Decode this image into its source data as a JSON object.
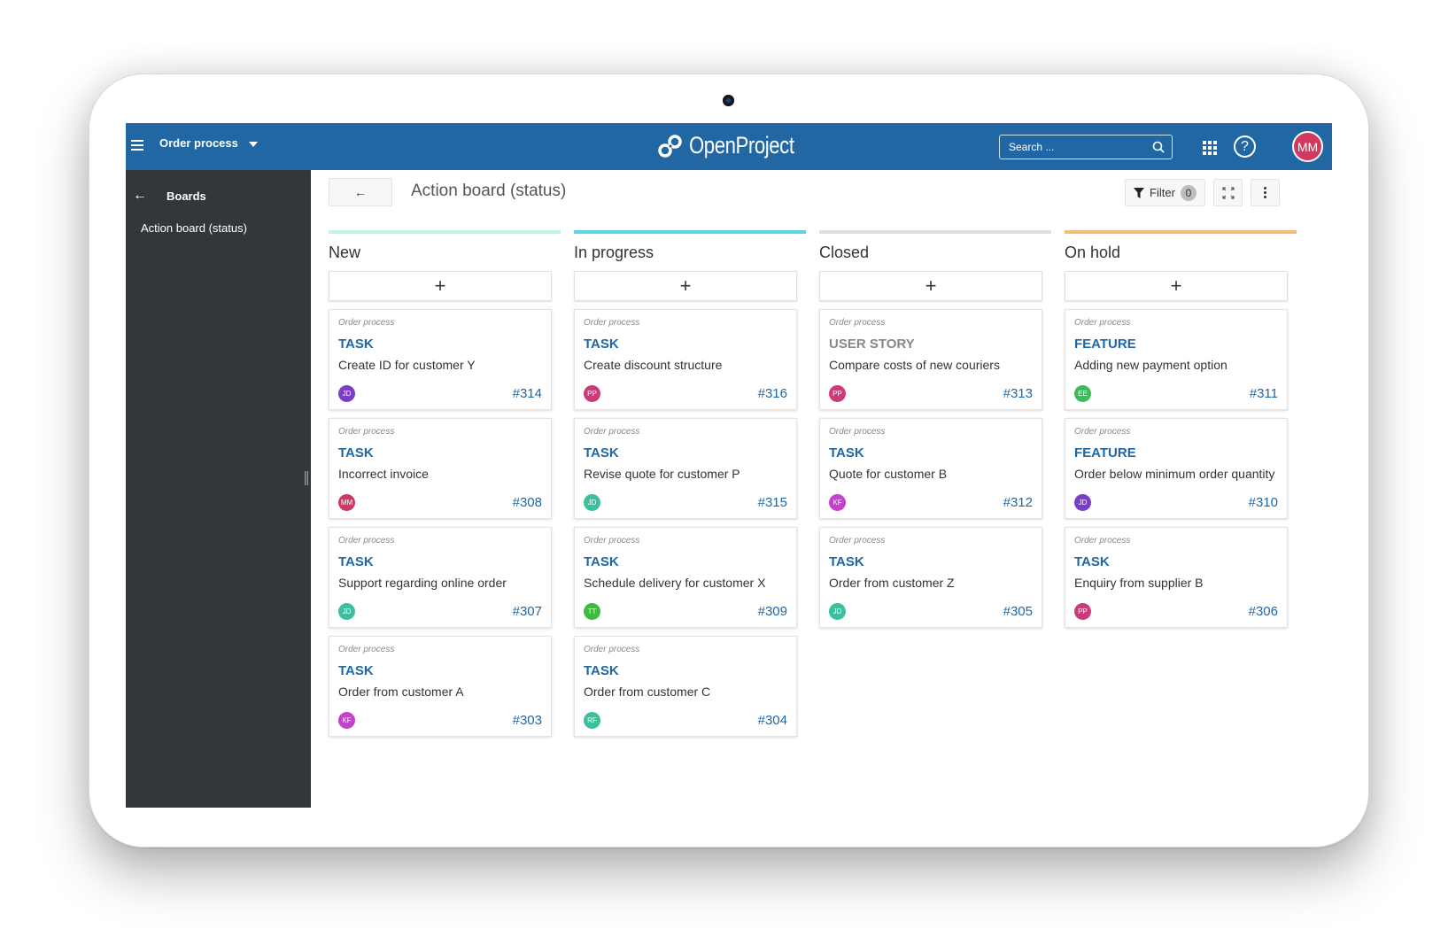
{
  "header": {
    "project_name": "Order process",
    "logo_text": "OpenProject",
    "search_placeholder": "Search ...",
    "user_initials": "MM",
    "brand_color": "#2067a3"
  },
  "sidebar": {
    "back_label": "Boards",
    "items": [
      {
        "label": "Action board (status)"
      }
    ]
  },
  "toolbar": {
    "back_icon": "←",
    "title": "Action board (status)",
    "filter_label": "Filter",
    "filter_count": "0"
  },
  "columns": [
    {
      "title": "New",
      "color": "#c3f5e3",
      "add_label": "+",
      "cards": [
        {
          "project": "Order process",
          "type": "TASK",
          "type_color": "#2067a3",
          "subject": "Create ID for customer Y",
          "initials": "JD",
          "avatar_color": "#7b3cc8",
          "id": "#314"
        },
        {
          "project": "Order process",
          "type": "TASK",
          "type_color": "#2067a3",
          "subject": "Incorrect invoice",
          "initials": "MM",
          "avatar_color": "#c73b66",
          "id": "#308"
        },
        {
          "project": "Order process",
          "type": "TASK",
          "type_color": "#2067a3",
          "subject": "Support regarding online order",
          "initials": "JD",
          "avatar_color": "#3dbf9e",
          "id": "#307"
        },
        {
          "project": "Order process",
          "type": "TASK",
          "type_color": "#2067a3",
          "subject": "Order from customer A",
          "initials": "KF",
          "avatar_color": "#c441c9",
          "id": "#303"
        }
      ]
    },
    {
      "title": "In progress",
      "color": "#5bd5e5",
      "add_label": "+",
      "cards": [
        {
          "project": "Order process",
          "type": "TASK",
          "type_color": "#2067a3",
          "subject": "Create discount structure",
          "initials": "PP",
          "avatar_color": "#cc3a7a",
          "id": "#316"
        },
        {
          "project": "Order process",
          "type": "TASK",
          "type_color": "#2067a3",
          "subject": "Revise quote for customer P",
          "initials": "JD",
          "avatar_color": "#3dbf9e",
          "id": "#315"
        },
        {
          "project": "Order process",
          "type": "TASK",
          "type_color": "#2067a3",
          "subject": "Schedule delivery for customer X",
          "initials": "TT",
          "avatar_color": "#3cbb3c",
          "id": "#309"
        },
        {
          "project": "Order process",
          "type": "TASK",
          "type_color": "#2067a3",
          "subject": "Order from customer C",
          "initials": "RF",
          "avatar_color": "#3dbf9e",
          "id": "#304"
        }
      ]
    },
    {
      "title": "Closed",
      "color": "#dcdfe3",
      "add_label": "+",
      "cards": [
        {
          "project": "Order process",
          "type": "USER STORY",
          "type_color": "#888888",
          "subject": "Compare costs of new couriers",
          "initials": "PP",
          "avatar_color": "#cc3a7a",
          "id": "#313"
        },
        {
          "project": "Order process",
          "type": "TASK",
          "type_color": "#2067a3",
          "subject": "Quote for customer B",
          "initials": "KF",
          "avatar_color": "#c441c9",
          "id": "#312"
        },
        {
          "project": "Order process",
          "type": "TASK",
          "type_color": "#2067a3",
          "subject": "Order from customer Z",
          "initials": "JD",
          "avatar_color": "#3dbf9e",
          "id": "#305"
        }
      ]
    },
    {
      "title": "On hold",
      "color": "#f6bd78",
      "add_label": "+",
      "cards": [
        {
          "project": "Order process",
          "type": "FEATURE",
          "type_color": "#2067a3",
          "subject": "Adding new payment option",
          "initials": "EE",
          "avatar_color": "#3cbb5a",
          "id": "#311"
        },
        {
          "project": "Order process",
          "type": "FEATURE",
          "type_color": "#2067a3",
          "subject": "Order below minimum order quantity",
          "initials": "JD",
          "avatar_color": "#7b3cc8",
          "id": "#310"
        },
        {
          "project": "Order process",
          "type": "TASK",
          "type_color": "#2067a3",
          "subject": "Enquiry from supplier B",
          "initials": "PP",
          "avatar_color": "#cc3a7a",
          "id": "#306"
        }
      ]
    }
  ]
}
